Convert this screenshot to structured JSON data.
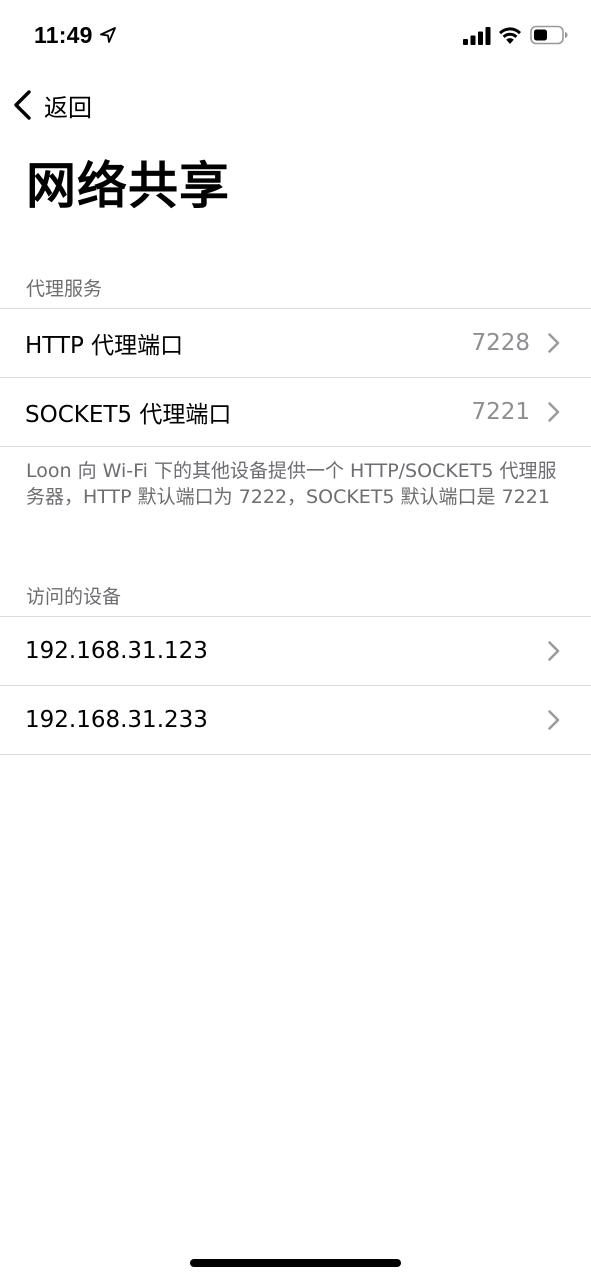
{
  "status_bar": {
    "time": "11:49",
    "icons": [
      "location-arrow-icon",
      "cellular-signal-icon",
      "wifi-icon",
      "battery-icon"
    ]
  },
  "nav": {
    "back_label": "返回",
    "title": "网络共享"
  },
  "proxy_section": {
    "header": "代理服务",
    "rows": [
      {
        "label": "HTTP 代理端口",
        "value": "7228"
      },
      {
        "label": "SOCKET5 代理端口",
        "value": "7221"
      }
    ],
    "footer": "Loon 向 Wi-Fi 下的其他设备提供一个 HTTP/SOCKET5 代理服务器，HTTP 默认端口为 7222，SOCKET5 默认端口是 7221"
  },
  "devices_section": {
    "header": "访问的设备",
    "rows": [
      {
        "label": "192.168.31.123"
      },
      {
        "label": "192.168.31.233"
      }
    ]
  },
  "colors": {
    "secondary_text": "#6d6d72",
    "value_text": "#8e8e93",
    "separator": "#dcdce0",
    "chevron": "#9a9a9f"
  }
}
